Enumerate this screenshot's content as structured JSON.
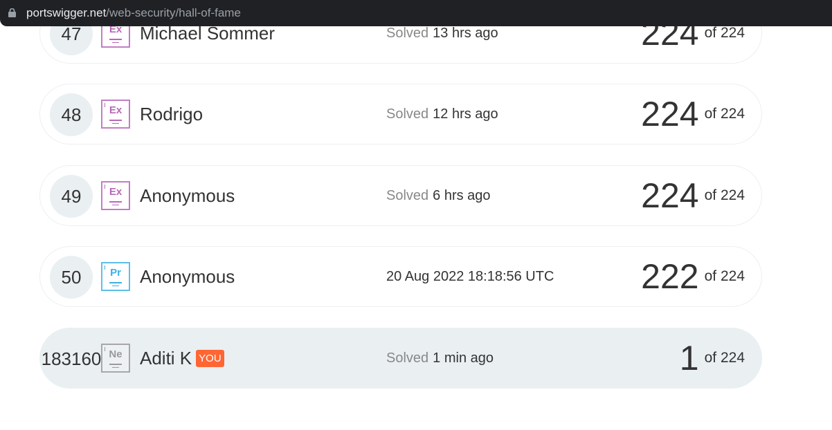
{
  "browser": {
    "url_host": "portswigger.net",
    "url_path": "/web-security/hall-of-fame"
  },
  "leaderboard": {
    "total_label": "of 224",
    "solved_label": "Solved",
    "rows": [
      {
        "rank": "47",
        "badge": "Ex",
        "name": "Michael Sommer",
        "solved_prefix": "Solved",
        "solved_time": "13 hrs ago",
        "score": "224",
        "of": "of 224"
      },
      {
        "rank": "48",
        "badge": "Ex",
        "name": "Rodrigo",
        "solved_prefix": "Solved",
        "solved_time": "12 hrs ago",
        "score": "224",
        "of": "of 224"
      },
      {
        "rank": "49",
        "badge": "Ex",
        "name": "Anonymous",
        "solved_prefix": "Solved",
        "solved_time": "6 hrs ago",
        "score": "224",
        "of": "of 224"
      },
      {
        "rank": "50",
        "badge": "Pr",
        "name": "Anonymous",
        "solved_prefix": "",
        "solved_time": "20 Aug 2022 18:18:56 UTC",
        "score": "222",
        "of": "of 224"
      },
      {
        "rank": "183160",
        "badge": "Ne",
        "name": "Aditi K",
        "you_label": "YOU",
        "solved_prefix": "Solved",
        "solved_time": "1 min ago",
        "score": "1",
        "of": "of 224"
      }
    ]
  },
  "colors": {
    "expert_badge": "#c27dc4",
    "practitioner_badge": "#5bbfea",
    "newbie_badge": "#a7a7a7",
    "you_badge": "#ff6633",
    "current_user_row": "#eaeff2"
  }
}
